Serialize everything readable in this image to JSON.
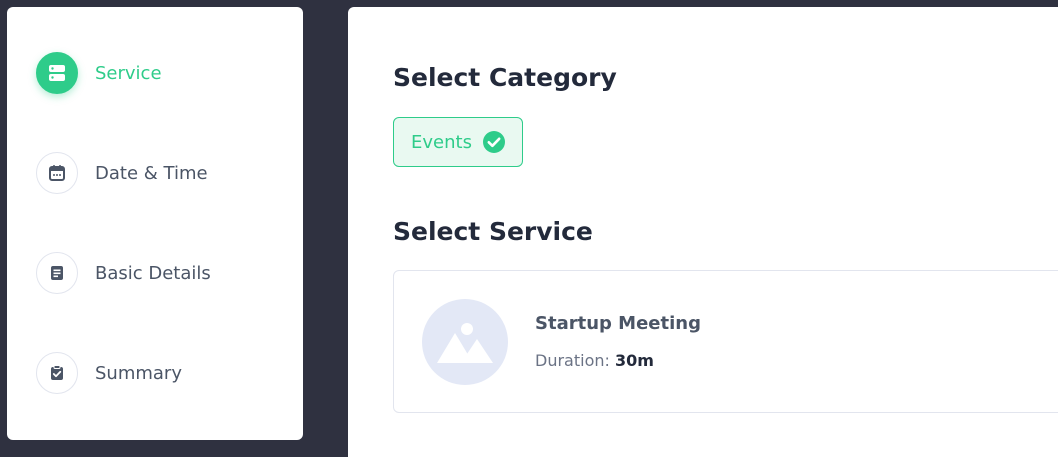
{
  "steps": [
    {
      "label": "Service",
      "icon": "server-icon",
      "active": true
    },
    {
      "label": "Date & Time",
      "icon": "calendar-icon",
      "active": false
    },
    {
      "label": "Basic Details",
      "icon": "document-icon",
      "active": false
    },
    {
      "label": "Summary",
      "icon": "clipboard-check-icon",
      "active": false
    }
  ],
  "category_section": {
    "title": "Select Category",
    "selected_chip": "Events"
  },
  "service_section": {
    "title": "Select Service",
    "service": {
      "name": "Startup Meeting",
      "duration_label": "Duration:",
      "duration_value": "30m"
    }
  },
  "colors": {
    "accent": "#2ecc8a",
    "background": "#2f3140",
    "text_dark": "#232a3b",
    "text_muted": "#4b5566"
  }
}
